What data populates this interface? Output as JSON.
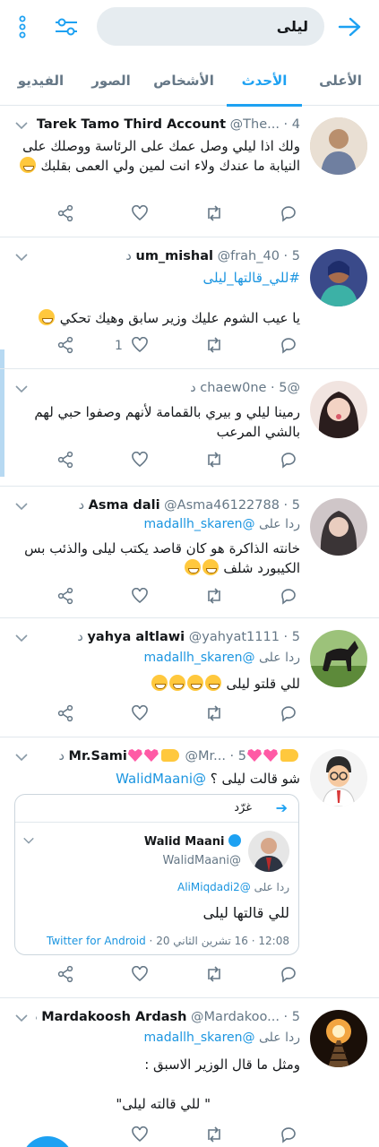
{
  "header": {
    "search_value": "ليلى",
    "icons": [
      "back-arrow-icon",
      "filter-sliders-icon",
      "more-vertical-icon"
    ]
  },
  "tabs": [
    {
      "label": "الأعلى",
      "active": false
    },
    {
      "label": "الأحدث",
      "active": true
    },
    {
      "label": "الأشخاص",
      "active": false
    },
    {
      "label": "الصور",
      "active": false
    },
    {
      "label": "الفيديو",
      "active": false
    }
  ],
  "tweets": [
    {
      "name": "Tarek Tamo Third Account",
      "meta": "@The... · 4 د",
      "text": "ولك اذا ليلي وصل عمك على الرئاسة ووصلك على النيابة ما عندك ولاء انت لمين ولي العمى بقلبك",
      "retweets": "",
      "replies": ""
    },
    {
      "name": "um_mishal",
      "meta": "@frah_40 · 5 د",
      "hashtag": "#للي_قالتها_ليلى",
      "text": "يا عيب الشوم عليك وزير سابق  وهيك تحكي",
      "replies": "1"
    },
    {
      "name": "",
      "meta": "@chaew0ne · 5 د",
      "text": "رمينا ليلي و بيري بالقمامة لأنهم وصفوا حبي لهم بالشي المرعب"
    },
    {
      "name": "Asma dali",
      "meta": "@Asma46122788 · 5 د",
      "reply_prefix": "ردا على",
      "reply_handle": "@madallh_skaren",
      "text": "خانته الذاكرة هو كان قاصد يكتب ليلى والذئب بس الكيبورد شلف"
    },
    {
      "name": "yahya altlawi",
      "meta": "@yahyat1111 · 5 د",
      "reply_prefix": "ردا على",
      "reply_handle": "@madallh_skaren",
      "text": "للي قلتو ليلى"
    },
    {
      "name": "Mr.Sami",
      "meta": "@Mr... · 5 د",
      "text": "شو قالت ليلى ؟",
      "mention": "@WalidMaani",
      "quote": {
        "translate": "غرّد",
        "name": "Walid Maani",
        "handle": "@WalidMaani",
        "reply_prefix": "ردا على",
        "reply_handle": "@AliMiqdadi2",
        "text": "للي قالتها ليلى",
        "footer": "12:08 · 16 تشرين الثاني 20 ·",
        "source": "Twitter for Android"
      }
    },
    {
      "name": "Mardakoosh Ardash",
      "meta": "@Mardakoo... · 5 د",
      "reply_prefix": "ردا على",
      "reply_handle": "@madallh_skaren",
      "text": "ومثل ما قال الوزير الاسبق :",
      "text2": "\" للي قالته ليلى\""
    }
  ],
  "colors": {
    "accent": "#1da1f2",
    "link": "#1b95e0",
    "muted": "#657786",
    "divider": "#e1e8ed",
    "search_bg": "#e6ecf0"
  }
}
